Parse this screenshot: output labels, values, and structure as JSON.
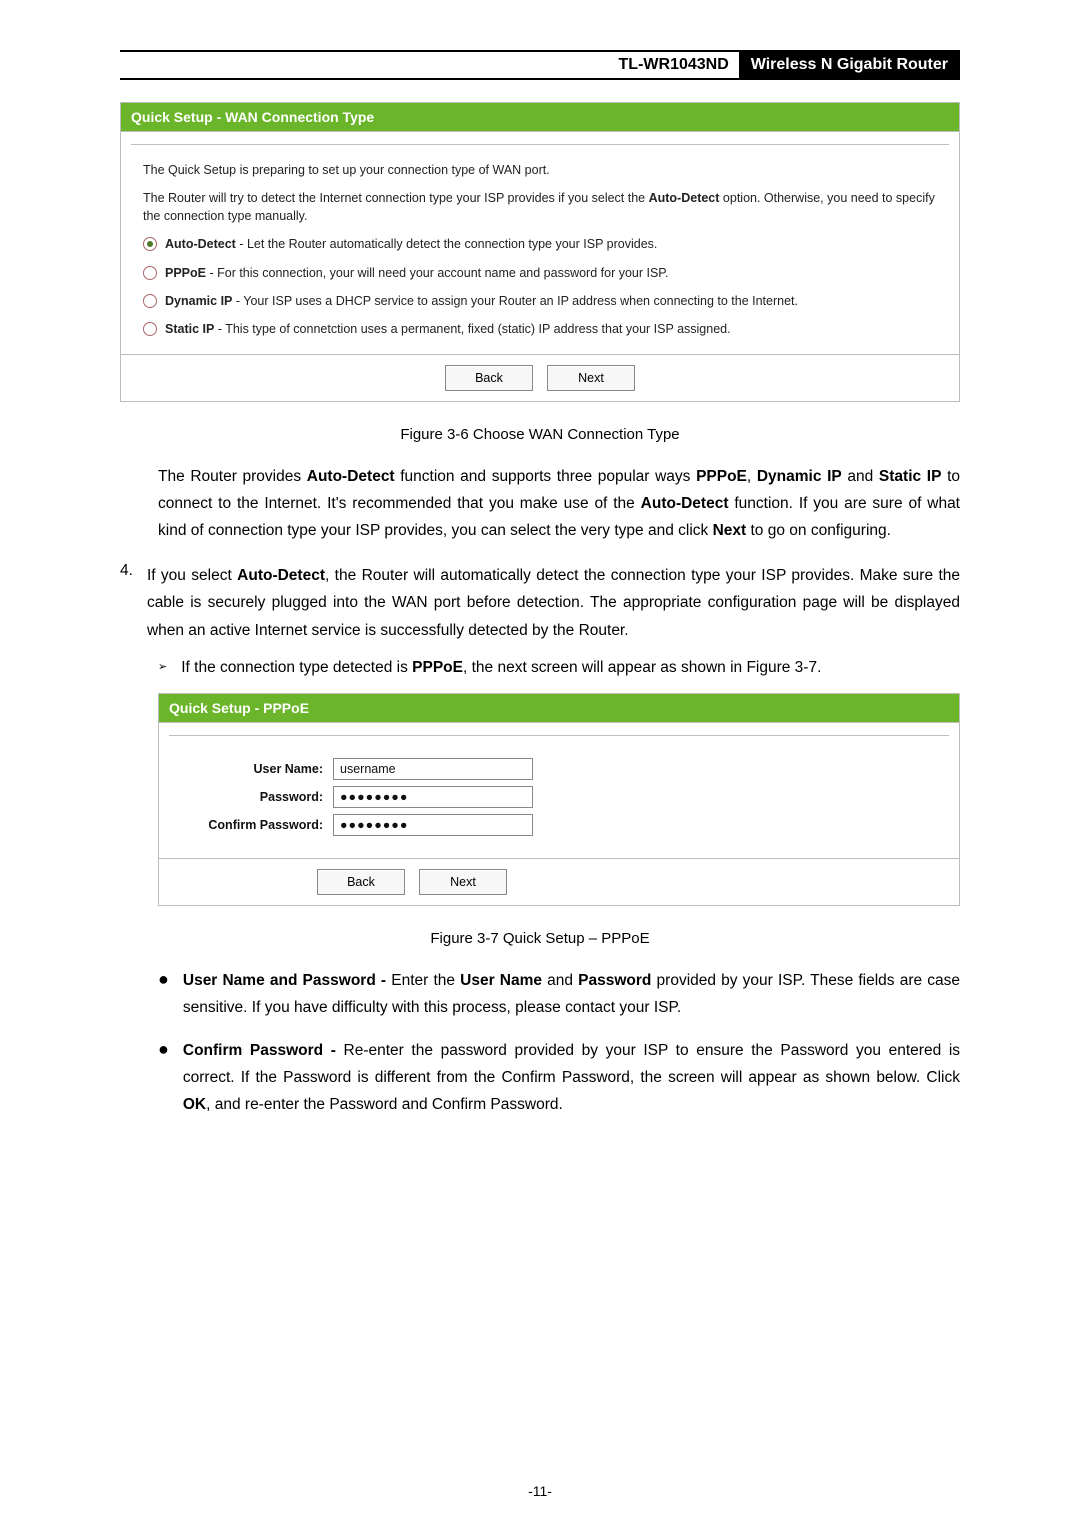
{
  "header": {
    "model": "TL-WR1043ND",
    "product": "Wireless N Gigabit Router"
  },
  "fig36": {
    "title": "Quick Setup - WAN Connection Type",
    "intro1": "The Quick Setup is preparing to set up your connection type of WAN port.",
    "intro2a": "The Router will try to detect the Internet connection type your ISP provides if you select the ",
    "intro2b": "Auto-Detect",
    "intro2c": " option. Otherwise, you need to specify the connection type manually.",
    "opt1b": "Auto-Detect",
    "opt1t": " - Let the Router automatically detect the connection type your ISP provides.",
    "opt2b": "PPPoE",
    "opt2t": " - For this connection, your will need your account name and password for your ISP.",
    "opt3b": "Dynamic IP",
    "opt3t": " - Your ISP uses a DHCP service to assign your Router an IP address when connecting to the Internet.",
    "opt4b": "Static IP",
    "opt4t": " - This type of connetction uses a permanent, fixed (static) IP address that your ISP assigned.",
    "back": "Back",
    "next": "Next",
    "caption": "Figure 3-6    Choose WAN Connection Type"
  },
  "para1": {
    "a": "The Router provides ",
    "b": "Auto-Detect",
    "c": " function and supports three popular ways ",
    "d": "PPPoE",
    "e": ", ",
    "f": "Dynamic IP",
    "g": " and ",
    "h": "Static IP",
    "i": " to connect to the Internet. It's recommended that you make use of the ",
    "j": "Auto-Detect",
    "k": " function. If you are sure of what kind of connection type your ISP provides, you can select the very type and click ",
    "l": "Next",
    "m": " to go on configuring."
  },
  "item4": {
    "num": "4.",
    "a": "If you select ",
    "b": "Auto-Detect",
    "c": ", the Router will automatically detect the connection type your ISP provides. Make sure the cable is securely plugged into the WAN port before detection. The appropriate configuration page will be displayed when an active Internet service is successfully detected by the Router."
  },
  "sub": {
    "a": "If the connection type detected is ",
    "b": "PPPoE",
    "c": ", the next screen will appear as shown in Figure 3-7."
  },
  "fig37": {
    "title": "Quick Setup - PPPoE",
    "user_label": "User Name:",
    "pass_label": "Password:",
    "confirm_label": "Confirm Password:",
    "user_value": "username",
    "pass_value": "●●●●●●●●",
    "confirm_value": "●●●●●●●●",
    "back": "Back",
    "next": "Next",
    "caption": "Figure 3-7    Quick Setup – PPPoE"
  },
  "bullet1": {
    "a": "User Name and Password - ",
    "b": "Enter the ",
    "c": "User Name",
    "d": " and ",
    "e": "Password",
    "f": " provided by your ISP. These fields are case sensitive. If you have difficulty with this process, please contact your ISP."
  },
  "bullet2": {
    "a": "Confirm Password - ",
    "b": "Re-enter the password provided by your ISP to ensure the Password you entered is correct. If the Password is different from the Confirm Password, the screen will appear as shown below. Click ",
    "c": "OK",
    "d": ", and re-enter the Password and Confirm Password."
  },
  "pagenum": "-11-"
}
